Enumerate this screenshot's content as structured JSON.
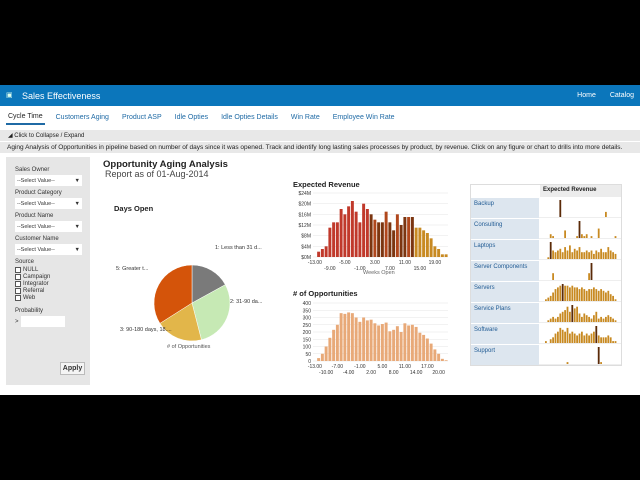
{
  "header": {
    "title": "Sales Effectiveness",
    "nav": [
      "Home",
      "Catalog"
    ]
  },
  "tabs": [
    "Cycle Time",
    "Customers Aging",
    "Product ASP",
    "Idle Opties",
    "Idle Opties Details",
    "Win Rate",
    "Employee Win Rate"
  ],
  "collapse_label": "Click to Collapse / Expand",
  "description": "Aging Analysis of Opportunities in pipeline based on number of days since it was opened. Track and identify long lasting sales processes by product, by revenue. Click on any figure or chart to drills into more details.",
  "filters": {
    "selects": [
      {
        "label": "Sales Owner",
        "value": "--Select Value--"
      },
      {
        "label": "Product Category",
        "value": "--Select Value--"
      },
      {
        "label": "Product Name",
        "value": "--Select Value--"
      },
      {
        "label": "Customer Name",
        "value": "--Select Value--"
      }
    ],
    "source_label": "Source",
    "sources": [
      "NULL",
      "Campaign",
      "Integrator",
      "Referral",
      "Web"
    ],
    "probability_label": "Probability",
    "probability_op": ">",
    "apply": "Apply"
  },
  "report": {
    "title": "Opportunity Aging Analysis",
    "subtitle": "Report as of 01-Aug-2014"
  },
  "chart_data": [
    {
      "type": "pie",
      "title": "Days Open",
      "footer": "# of Opportunities",
      "slices": [
        {
          "label": "1: Less than 31 d...",
          "value": 17,
          "color": "#7a7a7a"
        },
        {
          "label": "2: 31-90 da...",
          "value": 29,
          "color": "#c6e9b4"
        },
        {
          "label": "3: 90-180 days, 18....",
          "value": 20,
          "color": "#e2b64a"
        },
        {
          "label": "5: Greater t...",
          "value": 34,
          "color": "#d4540a"
        }
      ]
    },
    {
      "type": "bar",
      "title": "Expected Revenue",
      "xlabel": "Weeks Open",
      "ylim": [
        0,
        24
      ],
      "yticks": [
        "$0M",
        "$4M",
        "$8M",
        "$12M",
        "$16M",
        "$20M",
        "$24M"
      ],
      "xticks_top": [
        "-13.00",
        "-5.00",
        "3.00",
        "11.00",
        "19.00"
      ],
      "xticks_bottom": [
        "-9.00",
        "-1.00",
        "7.00",
        "15.00"
      ],
      "x_start": -13,
      "values": [
        0,
        2,
        3,
        4,
        11,
        13,
        13,
        18,
        16,
        19,
        21,
        17,
        13,
        20,
        18,
        16,
        14,
        13,
        13,
        17,
        13,
        10,
        16,
        12,
        15,
        15,
        15,
        11,
        11,
        10,
        9,
        7,
        4,
        3,
        1,
        1
      ]
    },
    {
      "type": "bar",
      "title": "# of Opportunities",
      "ylim": [
        0,
        400
      ],
      "yticks": [
        "0",
        "50",
        "100",
        "150",
        "200",
        "250",
        "300",
        "350",
        "400"
      ],
      "xticks_top": [
        "-13.00",
        "-7.00",
        "-1.00",
        "5.00",
        "11.00",
        "17.00"
      ],
      "xticks_bottom": [
        "-10.00",
        "-4.00",
        "2.00",
        "8.00",
        "14.00",
        "20.00"
      ],
      "x_start": -13,
      "values": [
        0,
        20,
        50,
        100,
        160,
        215,
        250,
        330,
        325,
        335,
        330,
        300,
        270,
        300,
        280,
        285,
        260,
        245,
        255,
        265,
        205,
        215,
        240,
        200,
        260,
        245,
        250,
        235,
        195,
        180,
        155,
        120,
        80,
        50,
        15,
        5
      ]
    },
    {
      "type": "table",
      "header": "Expected Revenue",
      "rows": [
        {
          "name": "Backup",
          "values": [
            0,
            0,
            0,
            0,
            0,
            0,
            10,
            0,
            0,
            0,
            0,
            0,
            0,
            0,
            0,
            0,
            0,
            0,
            0,
            0,
            0,
            0,
            0,
            0,
            0,
            3,
            0,
            0,
            0,
            0
          ]
        },
        {
          "name": "Consulting",
          "values": [
            0,
            0,
            2,
            1,
            0,
            0,
            0,
            0,
            4,
            0,
            0,
            0,
            0,
            1,
            9,
            2,
            1,
            2,
            0,
            1,
            0,
            0,
            5,
            0,
            0,
            0,
            0,
            0,
            0,
            1
          ]
        },
        {
          "name": "Laptops",
          "values": [
            0,
            1,
            10,
            5,
            4,
            5,
            6,
            4,
            7,
            5,
            8,
            4,
            6,
            5,
            7,
            4,
            4,
            5,
            4,
            5,
            3,
            5,
            4,
            6,
            4,
            4,
            7,
            5,
            4,
            3
          ]
        },
        {
          "name": "Server Components",
          "values": [
            0,
            0,
            0,
            2,
            0,
            0,
            0,
            0,
            0,
            0,
            0,
            0,
            0,
            0,
            0,
            0,
            0,
            0,
            2,
            5,
            0,
            0,
            0,
            0,
            0,
            0,
            0,
            0,
            0,
            0
          ]
        },
        {
          "name": "Servers",
          "values": [
            1,
            2,
            3,
            5,
            7,
            8,
            9,
            10,
            9,
            9,
            8,
            9,
            8,
            8,
            7,
            8,
            7,
            6,
            7,
            7,
            8,
            7,
            6,
            7,
            6,
            5,
            6,
            4,
            3,
            1
          ]
        },
        {
          "name": "Service Plans",
          "values": [
            0,
            1,
            2,
            3,
            2,
            3,
            5,
            6,
            7,
            9,
            6,
            10,
            8,
            9,
            5,
            3,
            5,
            4,
            3,
            2,
            4,
            6,
            2,
            3,
            2,
            3,
            4,
            3,
            2,
            1
          ]
        },
        {
          "name": "Software",
          "values": [
            1,
            0,
            2,
            3,
            5,
            6,
            8,
            7,
            6,
            8,
            5,
            6,
            5,
            4,
            5,
            6,
            4,
            5,
            4,
            5,
            6,
            9,
            4,
            3,
            3,
            3,
            4,
            3,
            1,
            1
          ]
        },
        {
          "name": "Support",
          "values": [
            0,
            0,
            0,
            0,
            0,
            0,
            0,
            0,
            0,
            1,
            0,
            0,
            0,
            0,
            0,
            0,
            0,
            0,
            0,
            0,
            0,
            0,
            9,
            1,
            0,
            0,
            0,
            0,
            0,
            0
          ]
        }
      ]
    }
  ]
}
